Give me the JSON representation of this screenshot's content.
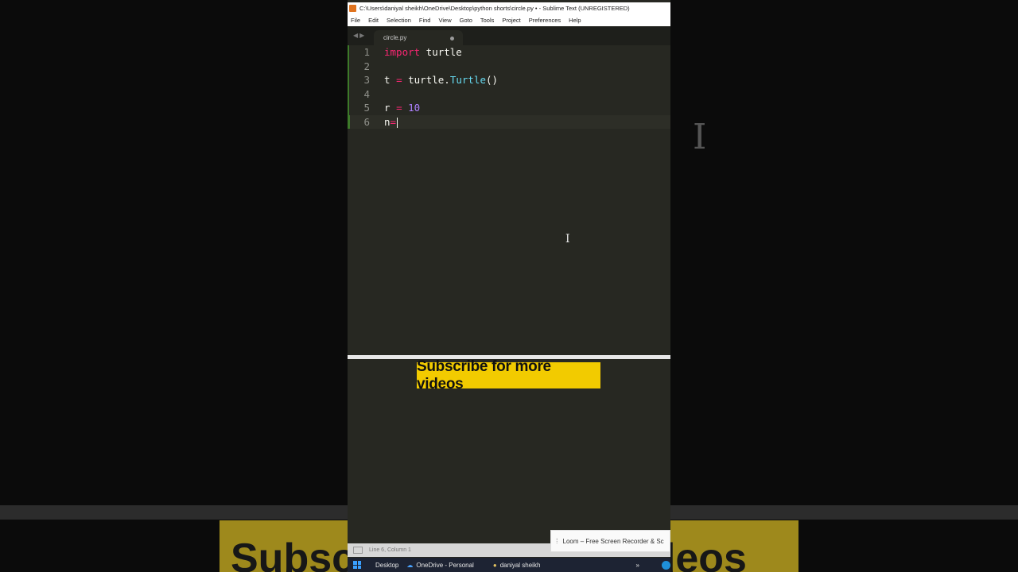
{
  "window": {
    "title": "C:\\Users\\daniyal sheikh\\OneDrive\\Desktop\\python shorts\\circle.py • - Sublime Text (UNREGISTERED)",
    "menu": [
      "File",
      "Edit",
      "Selection",
      "Find",
      "View",
      "Goto",
      "Tools",
      "Project",
      "Preferences",
      "Help"
    ]
  },
  "tabs": [
    {
      "label": "circle.py",
      "dirty": true
    }
  ],
  "editor": {
    "lines": [
      {
        "num": "1",
        "tokens": [
          [
            "kw",
            "import"
          ],
          [
            "plain",
            " turtle"
          ]
        ]
      },
      {
        "num": "2",
        "tokens": []
      },
      {
        "num": "3",
        "tokens": [
          [
            "plain",
            "t "
          ],
          [
            "op",
            "="
          ],
          [
            "plain",
            " turtle."
          ],
          [
            "fn",
            "Turtle"
          ],
          [
            "plain",
            "()"
          ]
        ]
      },
      {
        "num": "4",
        "tokens": []
      },
      {
        "num": "5",
        "tokens": [
          [
            "plain",
            "r "
          ],
          [
            "op",
            "="
          ],
          [
            "plain",
            " "
          ],
          [
            "num",
            "10"
          ]
        ]
      },
      {
        "num": "6",
        "tokens": [
          [
            "plain",
            "n"
          ],
          [
            "op",
            "="
          ]
        ],
        "current": true
      }
    ]
  },
  "overlay": {
    "subscribe": "Subscribe for more videos",
    "background_text": "Subscribe for more videos"
  },
  "status": {
    "position": "Line 6, Column 1"
  },
  "loom": {
    "label": "Loom – Free Screen Recorder & Sc"
  },
  "taskbar": {
    "items": [
      "Desktop",
      "OneDrive - Personal",
      "daniyal sheikh"
    ],
    "chevron": "»"
  },
  "colors": {
    "editor_bg": "#272822",
    "keyword": "#f92672",
    "function": "#66d9ef",
    "number": "#ae81ff",
    "subscribe_bg": "#f2cb00"
  }
}
